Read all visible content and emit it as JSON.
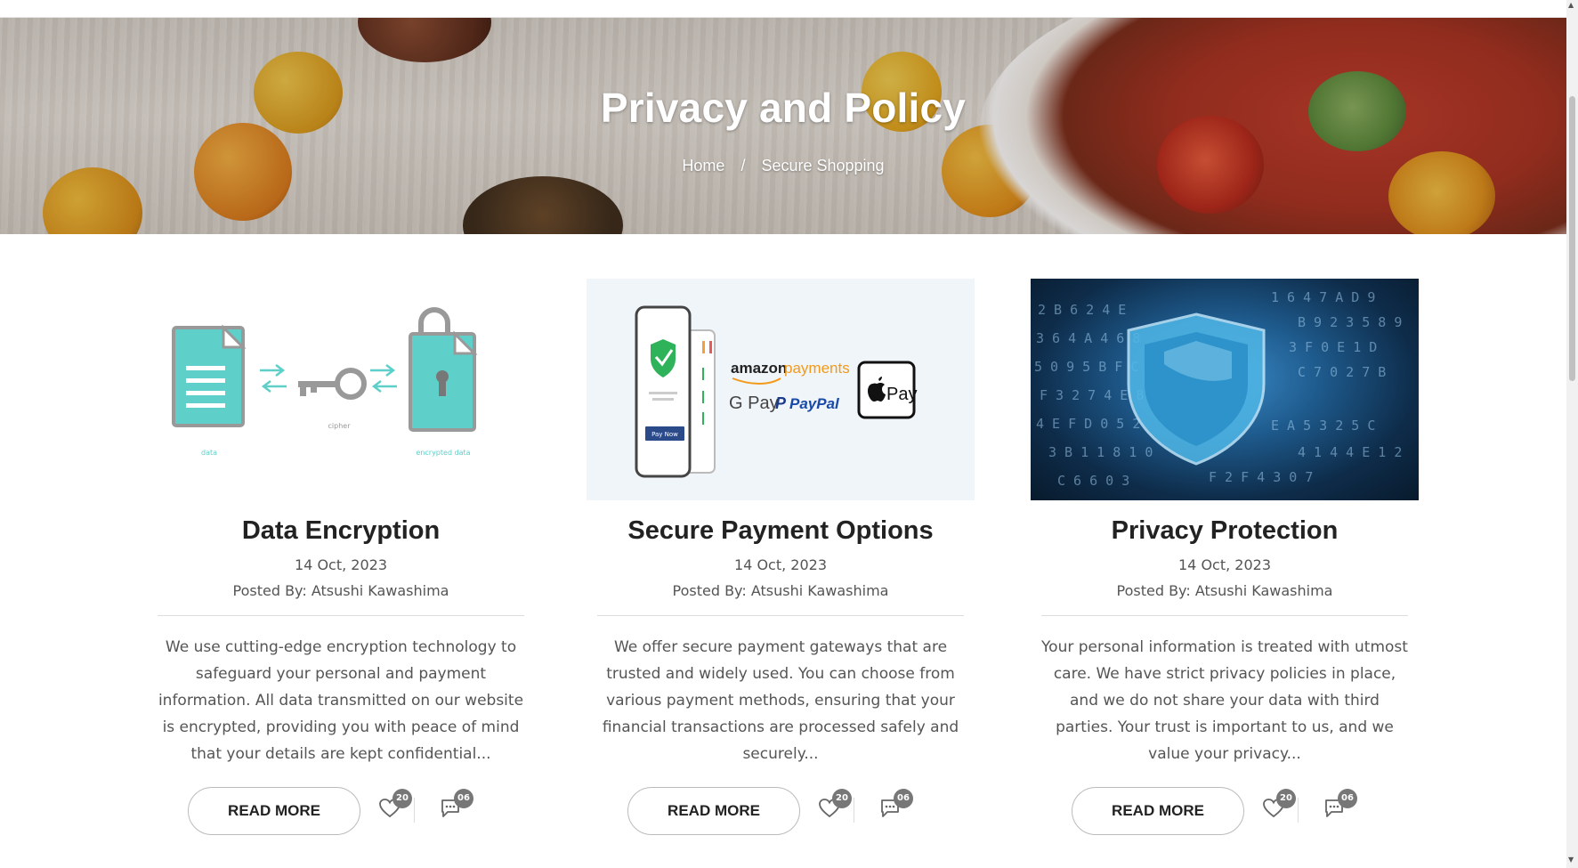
{
  "page": {
    "title": "Privacy and Policy",
    "breadcrumb": {
      "home": "Home",
      "separator": "/",
      "current": "Secure Shopping"
    }
  },
  "colors": {
    "accent": "#5fcfc9",
    "text_dark": "#222222",
    "text_muted": "#555555",
    "badge": "#777777"
  },
  "cards": [
    {
      "title": "Data Encryption",
      "date": "14 Oct, 2023",
      "author": "Posted By: Atsushi Kawashima",
      "excerpt": "We use cutting-edge encryption technology to safeguard your personal and payment information. All data transmitted on our website is encrypted, providing you with peace of mind that your details are kept confidential...",
      "button": "READ MORE",
      "likes": "20",
      "comments": "06",
      "image": {
        "label_data": "data",
        "label_cipher": "cipher",
        "label_encrypted": "encrypted data"
      }
    },
    {
      "title": "Secure Payment Options",
      "date": "14 Oct, 2023",
      "author": "Posted By: Atsushi Kawashima",
      "excerpt": "We offer secure payment gateways that are trusted and widely used. You can choose from various payment methods, ensuring that your financial transactions are processed safely and securely...",
      "button": "READ MORE",
      "likes": "20",
      "comments": "06",
      "image": {
        "pay_now": "Pay Now",
        "amazon": "amazon",
        "amazon_payments": "payments",
        "gpay": "G Pay",
        "paypal": "PayPal",
        "applepay": "Pay"
      }
    },
    {
      "title": "Privacy Protection",
      "date": "14 Oct, 2023",
      "author": "Posted By: Atsushi Kawashima",
      "excerpt": "Your personal information is treated with utmost care. We have strict privacy policies in place, and we do not share your data with third parties. Your trust is important to us, and we value your privacy...",
      "button": "READ MORE",
      "likes": "20",
      "comments": "06",
      "image": {}
    }
  ]
}
